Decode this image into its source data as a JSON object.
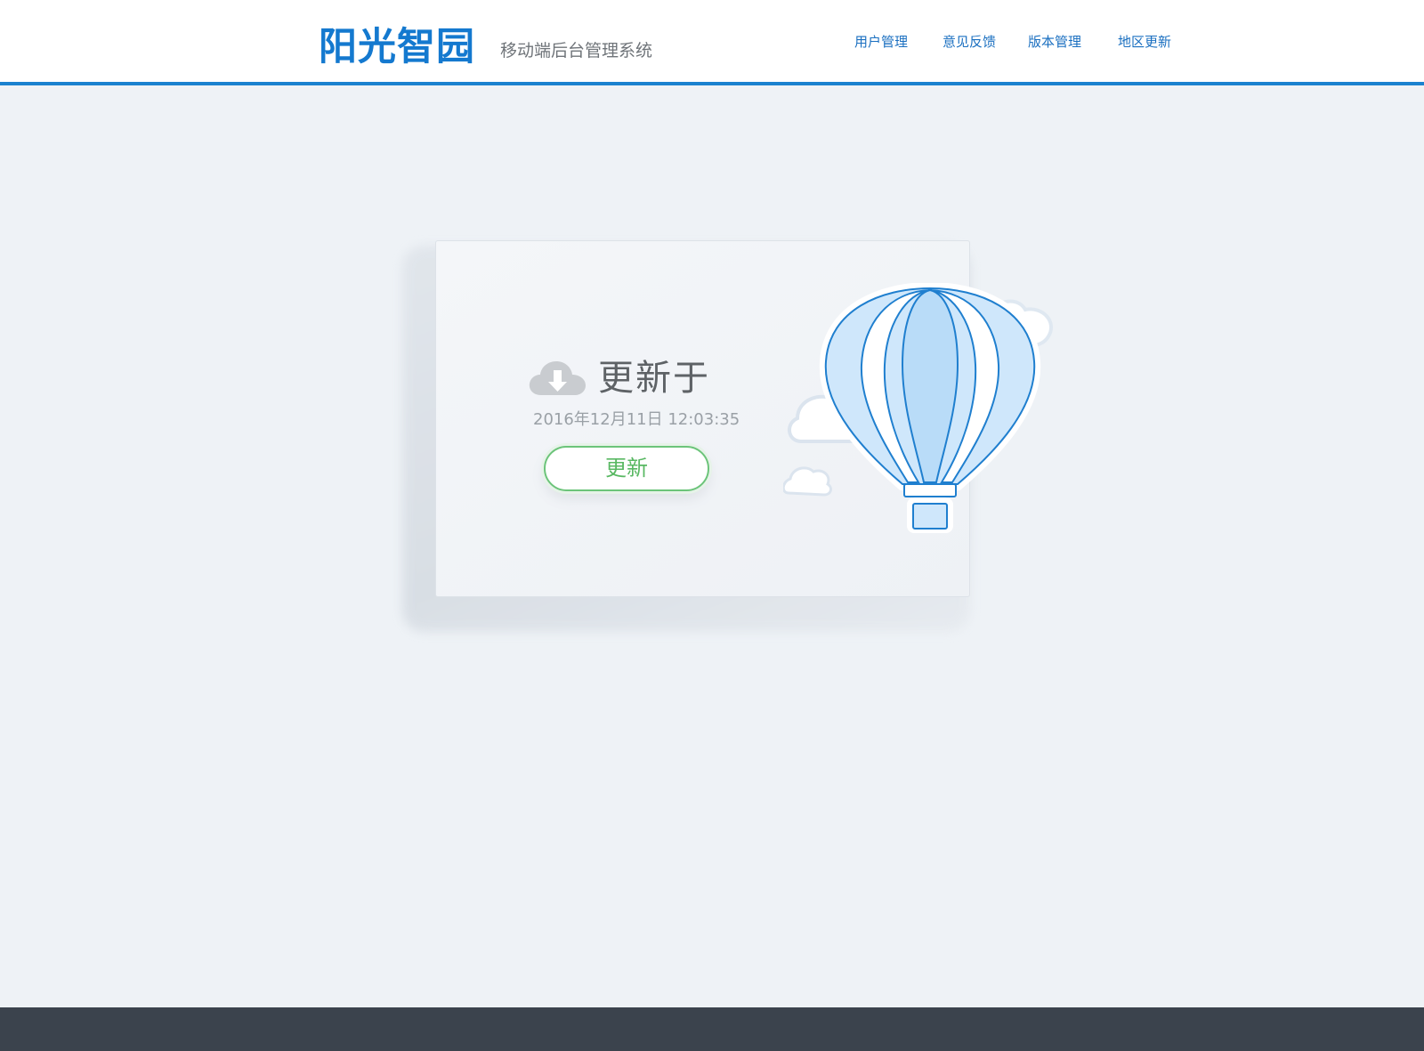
{
  "header": {
    "logo_text": "阳光智园",
    "subtitle": "移动端后台管理系统",
    "nav": [
      {
        "label": "用户管理"
      },
      {
        "label": "意见反馈"
      },
      {
        "label": "版本管理"
      },
      {
        "label": "地区更新"
      }
    ]
  },
  "card": {
    "heading": "更新于",
    "timestamp": "2016年12月11日 12:03:35",
    "button_label": "更新",
    "icon": "cloud-download-icon",
    "illustration": "hot-air-balloon-with-clouds"
  },
  "colors": {
    "brand_blue": "#1479cf",
    "header_border": "#1a82cf",
    "button_green": "#59b863",
    "page_bg": "#eef2f6",
    "footer_bg": "#3b434d"
  }
}
